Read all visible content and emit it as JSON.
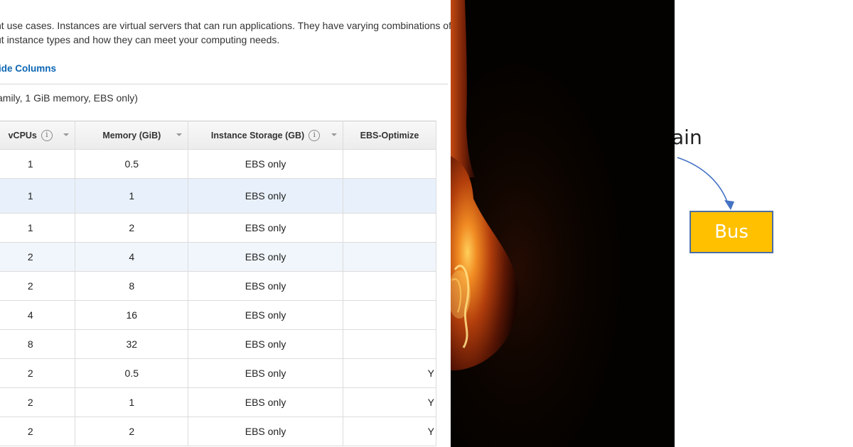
{
  "intro": {
    "line1": "nt use cases. Instances are virtual servers that can run applications. They have varying combinations of CP",
    "line2": "ut instance types and how they can meet your computing needs."
  },
  "hide_columns_label": "ide Columns",
  "selected_summary": "amily, 1 GiB memory, EBS only)",
  "table": {
    "headers": {
      "vcpus": "vCPUs",
      "memory": "Memory (GiB)",
      "storage": "Instance Storage (GB)",
      "ebs": "EBS-Optimize"
    },
    "rows": [
      {
        "vcpus": "1",
        "memory": "0.5",
        "storage": "EBS only",
        "ebs": ""
      },
      {
        "vcpus": "1",
        "memory": "1",
        "storage": "EBS only",
        "ebs": ""
      },
      {
        "vcpus": "1",
        "memory": "2",
        "storage": "EBS only",
        "ebs": ""
      },
      {
        "vcpus": "2",
        "memory": "4",
        "storage": "EBS only",
        "ebs": ""
      },
      {
        "vcpus": "2",
        "memory": "8",
        "storage": "EBS only",
        "ebs": ""
      },
      {
        "vcpus": "4",
        "memory": "16",
        "storage": "EBS only",
        "ebs": ""
      },
      {
        "vcpus": "8",
        "memory": "32",
        "storage": "EBS only",
        "ebs": ""
      },
      {
        "vcpus": "2",
        "memory": "0.5",
        "storage": "EBS only",
        "ebs": "Y"
      },
      {
        "vcpus": "2",
        "memory": "1",
        "storage": "EBS only",
        "ebs": "Y"
      },
      {
        "vcpus": "2",
        "memory": "2",
        "storage": "EBS only",
        "ebs": "Y"
      }
    ]
  },
  "diagram": {
    "main_label": "ain",
    "bus_label": "Bus"
  },
  "colors": {
    "link": "#0b66b3",
    "row_highlight": "#e8f1fb",
    "bus_fill": "#ffc000",
    "bus_border": "#4a6fa5",
    "arrow": "#4472c4"
  }
}
